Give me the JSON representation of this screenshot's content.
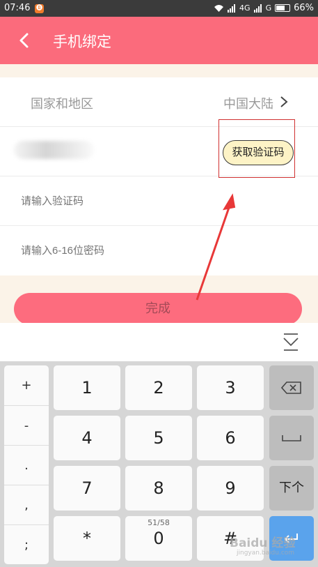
{
  "status_bar": {
    "time": "07:46",
    "notification": "🅑",
    "network": "4G",
    "network2": "G",
    "battery_percent": "66%"
  },
  "header": {
    "title": "手机绑定"
  },
  "form": {
    "region_label": "国家和地区",
    "region_value": "中国大陆",
    "get_code_label": "获取验证码",
    "code_placeholder": "请输入验证码",
    "password_placeholder": "请输入6-16位密码",
    "submit_label": "完成"
  },
  "keyboard": {
    "side_keys": [
      "+",
      "-",
      ".",
      ",",
      ";"
    ],
    "digits": [
      "1",
      "2",
      "3",
      "4",
      "5",
      "6",
      "7",
      "8",
      "9",
      "*",
      "0",
      "#"
    ],
    "zero_sub": "51/58",
    "next_label": "下个"
  },
  "watermark": {
    "brand": "Baidu 经验",
    "url": "jingyan.baidu.com"
  },
  "colors": {
    "header": "#fb6b7c",
    "submit": "#fd6c7e",
    "annotation": "#e83838",
    "highlight": "#fdf3c6"
  }
}
